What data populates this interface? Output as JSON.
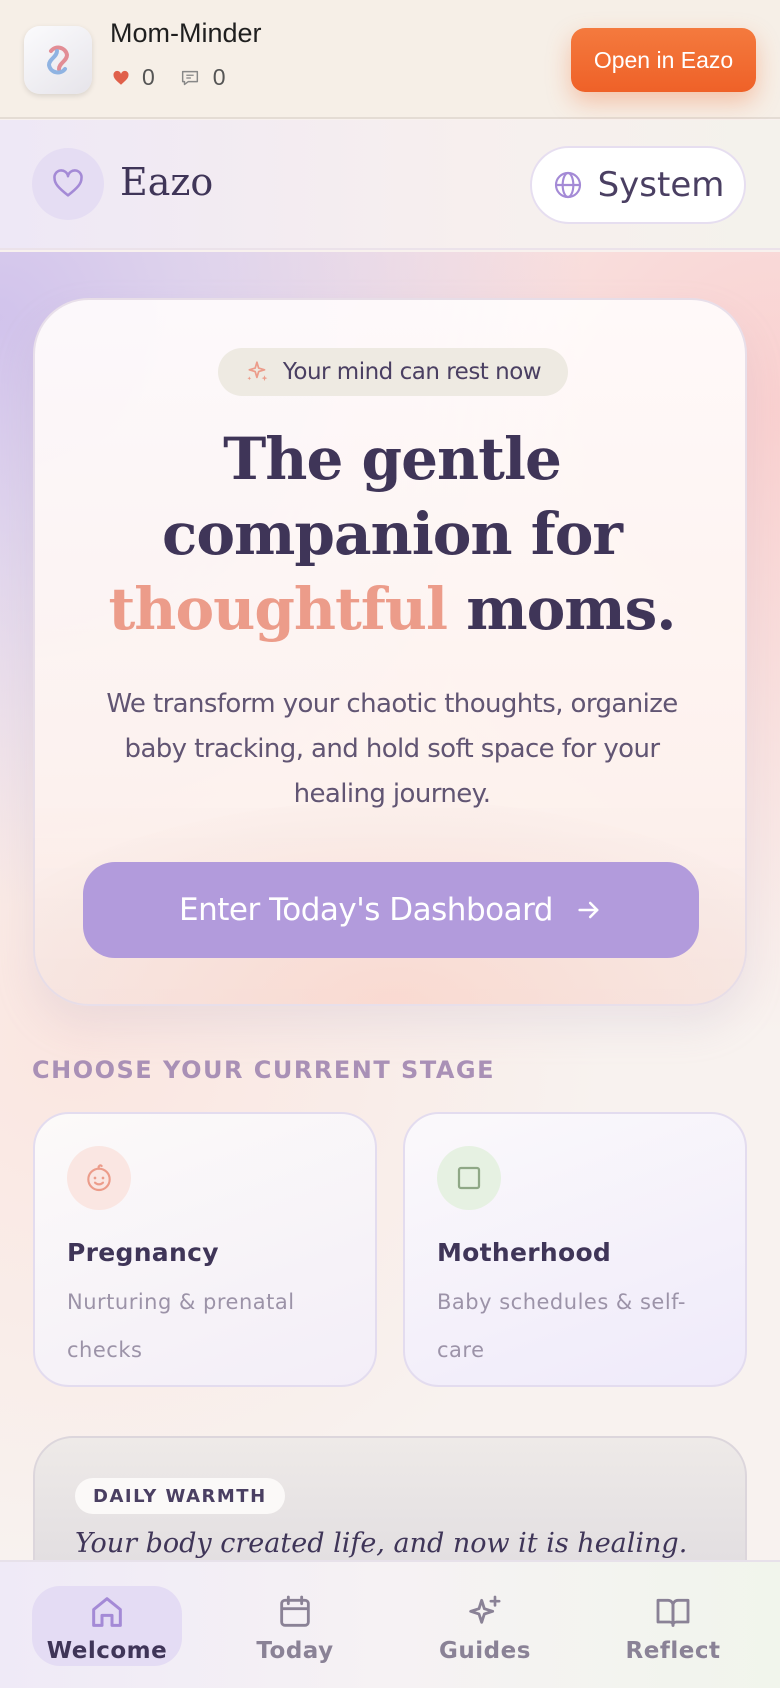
{
  "appbar": {
    "app_name": "Mom-Minder",
    "likes": "0",
    "comments": "0",
    "open_button": "Open in Eazo"
  },
  "header": {
    "brand": "Eazo",
    "language_button": "System"
  },
  "hero": {
    "pill_text": "Your mind can rest now",
    "headline_line1": "The gentle",
    "headline_line2": "companion for",
    "headline_accent": "thoughtful",
    "headline_end": "moms.",
    "subtext": "We transform your chaotic thoughts, organize baby tracking, and hold soft space for your healing journey.",
    "cta_label": "Enter Today's Dashboard"
  },
  "stages": {
    "title": "CHOOSE YOUR CURRENT STAGE",
    "items": [
      {
        "name": "Pregnancy",
        "desc": "Nurturing & prenatal checks",
        "icon": "baby-face-icon"
      },
      {
        "name": "Motherhood",
        "desc": "Baby schedules & self-care",
        "icon": "square-icon"
      }
    ]
  },
  "warmth": {
    "label": "DAILY WARMTH",
    "quote": "Your body created life, and now it is healing."
  },
  "nav": {
    "items": [
      {
        "label": "Welcome",
        "icon": "home-icon",
        "active": true
      },
      {
        "label": "Today",
        "icon": "calendar-icon",
        "active": false
      },
      {
        "label": "Guides",
        "icon": "sparkle-icon",
        "active": false
      },
      {
        "label": "Reflect",
        "icon": "book-icon",
        "active": false
      }
    ]
  },
  "colors": {
    "accent_purple": "#b29bdc",
    "accent_coral": "#ec9c8a",
    "open_button_orange": "#f06a30",
    "text_dark": "#3f3558"
  }
}
